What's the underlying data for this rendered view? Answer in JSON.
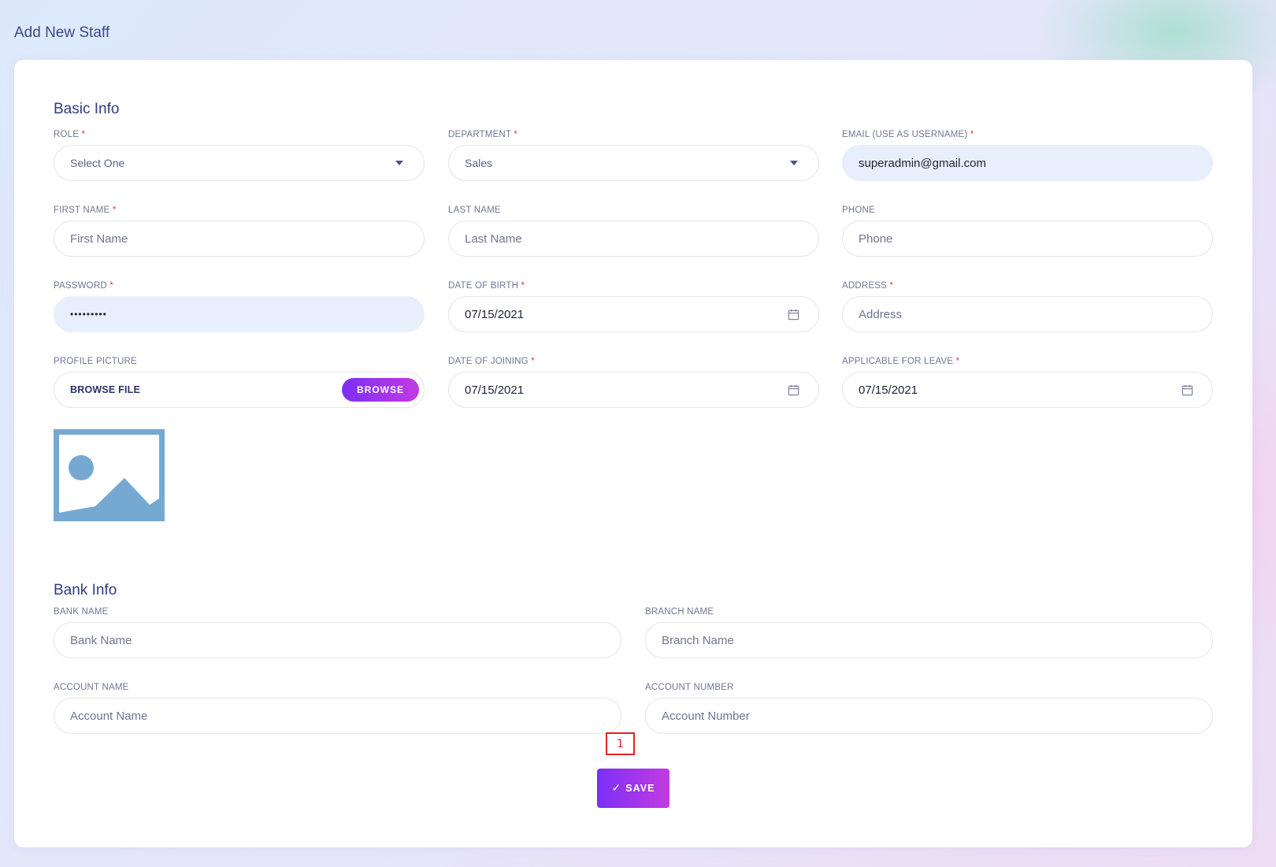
{
  "page": {
    "title": "Add New Staff"
  },
  "basic_info": {
    "title": "Basic Info",
    "role": {
      "label": "ROLE",
      "value": "Select One"
    },
    "department": {
      "label": "DEPARTMENT",
      "value": "Sales"
    },
    "email": {
      "label": "EMAIL (USE AS USERNAME)",
      "value": "superadmin@gmail.com"
    },
    "first_name": {
      "label": "FIRST NAME",
      "placeholder": "First Name"
    },
    "last_name": {
      "label": "LAST NAME",
      "placeholder": "Last Name"
    },
    "phone": {
      "label": "PHONE",
      "placeholder": "Phone"
    },
    "password": {
      "label": "PASSWORD",
      "value": "•••••••••"
    },
    "date_of_birth": {
      "label": "DATE OF BIRTH",
      "value": "07/15/2021"
    },
    "address": {
      "label": "ADDRESS",
      "placeholder": "Address"
    },
    "profile_picture": {
      "label": "PROFILE PICTURE",
      "file_text": "BROWSE FILE",
      "button": "BROWSE"
    },
    "date_of_joining": {
      "label": "DATE OF JOINING",
      "value": "07/15/2021"
    },
    "applicable_for_leave": {
      "label": "APPLICABLE FOR LEAVE",
      "value": "07/15/2021"
    },
    "required_mark": "*"
  },
  "bank_info": {
    "title": "Bank Info",
    "bank_name": {
      "label": "BANK NAME",
      "placeholder": "Bank Name"
    },
    "branch_name": {
      "label": "BRANCH NAME",
      "placeholder": "Branch Name"
    },
    "account_name": {
      "label": "ACCOUNT NAME",
      "placeholder": "Account Name"
    },
    "account_number": {
      "label": "ACCOUNT NUMBER",
      "placeholder": "Account Number"
    }
  },
  "marker": {
    "text": "1"
  },
  "actions": {
    "save_label": "SAVE",
    "save_icon": "✓"
  },
  "colors": {
    "accent_start": "#7b2ff7",
    "accent_end": "#c33be0",
    "title": "#2f3d7c",
    "required": "#e5383b",
    "image_placeholder": "#76a9d2"
  }
}
